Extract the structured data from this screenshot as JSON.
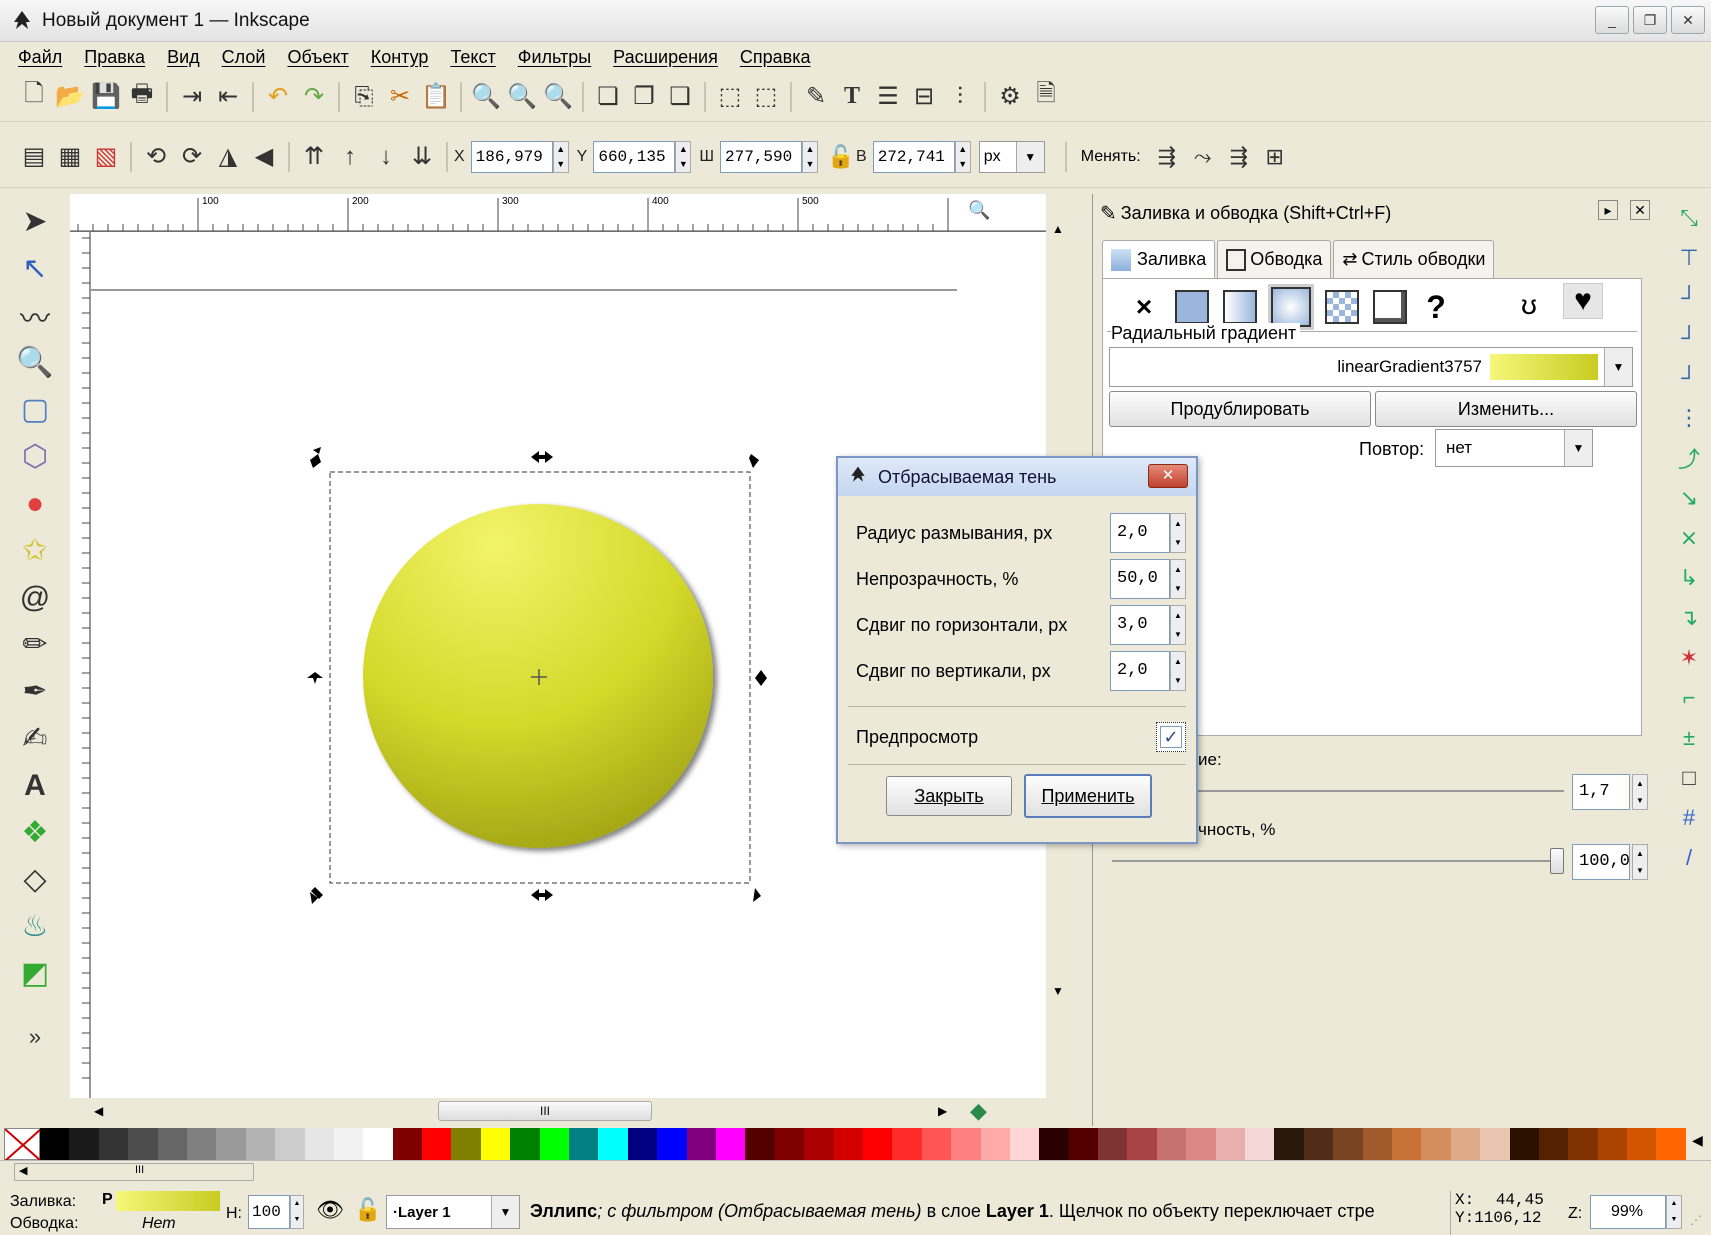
{
  "window": {
    "title": "Новый документ 1 — Inkscape",
    "controls": [
      "_",
      "❐",
      "✕"
    ]
  },
  "menu": [
    "Файл",
    "Правка",
    "Вид",
    "Слой",
    "Объект",
    "Контур",
    "Текст",
    "Фильтры",
    "Расширения",
    "Справка"
  ],
  "toolctrl": {
    "x_label": "X",
    "x_value": "186,979",
    "y_label": "Y",
    "y_value": "660,135",
    "w_label": "Ш",
    "w_value": "277,590",
    "h_label": "В",
    "h_value": "272,741",
    "unit": "px",
    "change_label": "Менять:"
  },
  "ruler_ticks": [
    "100",
    "200",
    "300",
    "400",
    "500"
  ],
  "dock": {
    "title": "Заливка и обводка (Shift+Ctrl+F)",
    "tabs": [
      "Заливка",
      "Обводка",
      "Стиль обводки"
    ],
    "unset_glyph": "×",
    "unknown_glyph": "?",
    "section": "Радиальный градиент",
    "gradient_name": "linearGradient3757",
    "duplicate_button": "Продублировать",
    "edit_button": "Изменить...",
    "repeat_label": "Повтор:",
    "repeat_value": "нет",
    "blur_label_partial": "ие:",
    "blur_value": "1,7",
    "opacity_label_partial": "чность, %",
    "opacity_value": "100,0",
    "opacity_level": 1.0
  },
  "dialog": {
    "title": "Отбрасываемая тень",
    "close_glyph": "✕",
    "fields": [
      {
        "label": "Радиус размывания, px",
        "value": "2,0"
      },
      {
        "label": "Непрозрачность, %",
        "value": "50,0"
      },
      {
        "label": "Сдвиг по горизонтали, px",
        "value": "3,0"
      },
      {
        "label": "Сдвиг по вертикали, px",
        "value": "2,0"
      }
    ],
    "preview_label": "Предпросмотр",
    "preview_checked": true,
    "preview_check": "✓",
    "close_button": "Закрыть",
    "apply_button": "Применить"
  },
  "expand_glyph": "»",
  "scroll_thumb_glyph": "III",
  "palette": [
    "#000000",
    "#1a1a1a",
    "#333333",
    "#4d4d4d",
    "#666666",
    "#808080",
    "#999999",
    "#b3b3b3",
    "#cccccc",
    "#e6e6e6",
    "#f2f2f2",
    "#ffffff",
    "#800000",
    "#ff0000",
    "#808000",
    "#ffff00",
    "#008000",
    "#00ff00",
    "#008080",
    "#00ffff",
    "#000080",
    "#0000ff",
    "#800080",
    "#ff00ff",
    "#550000",
    "#800000",
    "#aa0000",
    "#d40000",
    "#ff0000",
    "#ff2a2a",
    "#ff5555",
    "#ff8080",
    "#ffaaaa",
    "#ffd5d5",
    "#2b0000",
    "#550000",
    "#803333",
    "#aa4444",
    "#c87171",
    "#de8787",
    "#e9afaf",
    "#f4d7d7",
    "#28170b",
    "#502d16",
    "#784421",
    "#a05a2c",
    "#c87137",
    "#d38d5f",
    "#deaa87",
    "#e9c6af",
    "#2b1100",
    "#552200",
    "#803300",
    "#aa4400",
    "#d45500",
    "#ff6600"
  ],
  "status": {
    "fill_label": "Заливка:",
    "fill_type": "P",
    "stroke_label": "Обводка:",
    "stroke_value": "Нет",
    "h_label": "H:",
    "h_value": "100",
    "layer": "·Layer 1",
    "msg_obj": "Эллипс",
    "msg_filter": "; с фильтром (Отбрасываемая тень)",
    "msg_mid": " в слое ",
    "msg_layer": "Layer 1",
    "msg_tail": ". Щелчок по объекту переключает стре",
    "x_label": "X:",
    "x_coord": "44,45",
    "y_label": "Y:",
    "y_coord": "1106,12",
    "zoom_label": "Z:",
    "zoom": "99%"
  }
}
